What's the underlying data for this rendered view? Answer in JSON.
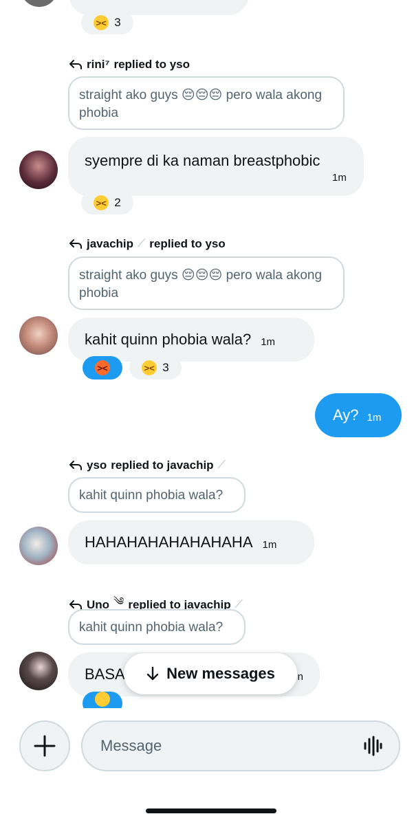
{
  "messages": [
    {
      "reactions": [
        {
          "emoji": "laughing-face-icon",
          "count": "3"
        }
      ]
    },
    {
      "reply_header": {
        "author": "rini⁷",
        "text": "replied to yso"
      },
      "quote": "straight ako guys 😔😔😔 pero wala akong phobia",
      "body": "syempre di ka naman breastphobic",
      "time": "1m",
      "reactions": [
        {
          "emoji": "laughing-face-icon",
          "count": "2"
        }
      ]
    },
    {
      "reply_header": {
        "author": "javachip",
        "target": "yso",
        "text": "replied to yso"
      },
      "quote": "straight ako guys 😔😔😔 pero wala akong phobia",
      "body": "kahit quinn phobia wala?",
      "time": "1m",
      "reactions": [
        {
          "emoji": "angry-face-icon",
          "count": ""
        },
        {
          "emoji": "laughing-face-icon",
          "count": "3"
        }
      ]
    },
    {
      "outgoing": true,
      "body": "Ay?",
      "time": "1m"
    },
    {
      "reply_header": {
        "author": "yso",
        "text": "replied to javachip"
      },
      "quote": "kahit quinn phobia wala?",
      "body": "HAHAHAHAHAHAHAHA",
      "time": "1m"
    },
    {
      "reply_header": {
        "author": "Uno",
        "text": "replied to javachip"
      },
      "quote": "kahit quinn phobia wala?",
      "body": "BASA",
      "time": "n"
    }
  ],
  "new_messages_pill": {
    "label": "New messages",
    "icon": "arrow-down-icon"
  },
  "composer": {
    "placeholder": "Message",
    "add_icon": "plus-icon",
    "voice_icon": "voice-wave-icon"
  },
  "colors": {
    "accent": "#1d9bf0",
    "bubble": "#eff3f4",
    "border": "#cfd9de",
    "text": "#0f1419",
    "muted": "#536471"
  }
}
